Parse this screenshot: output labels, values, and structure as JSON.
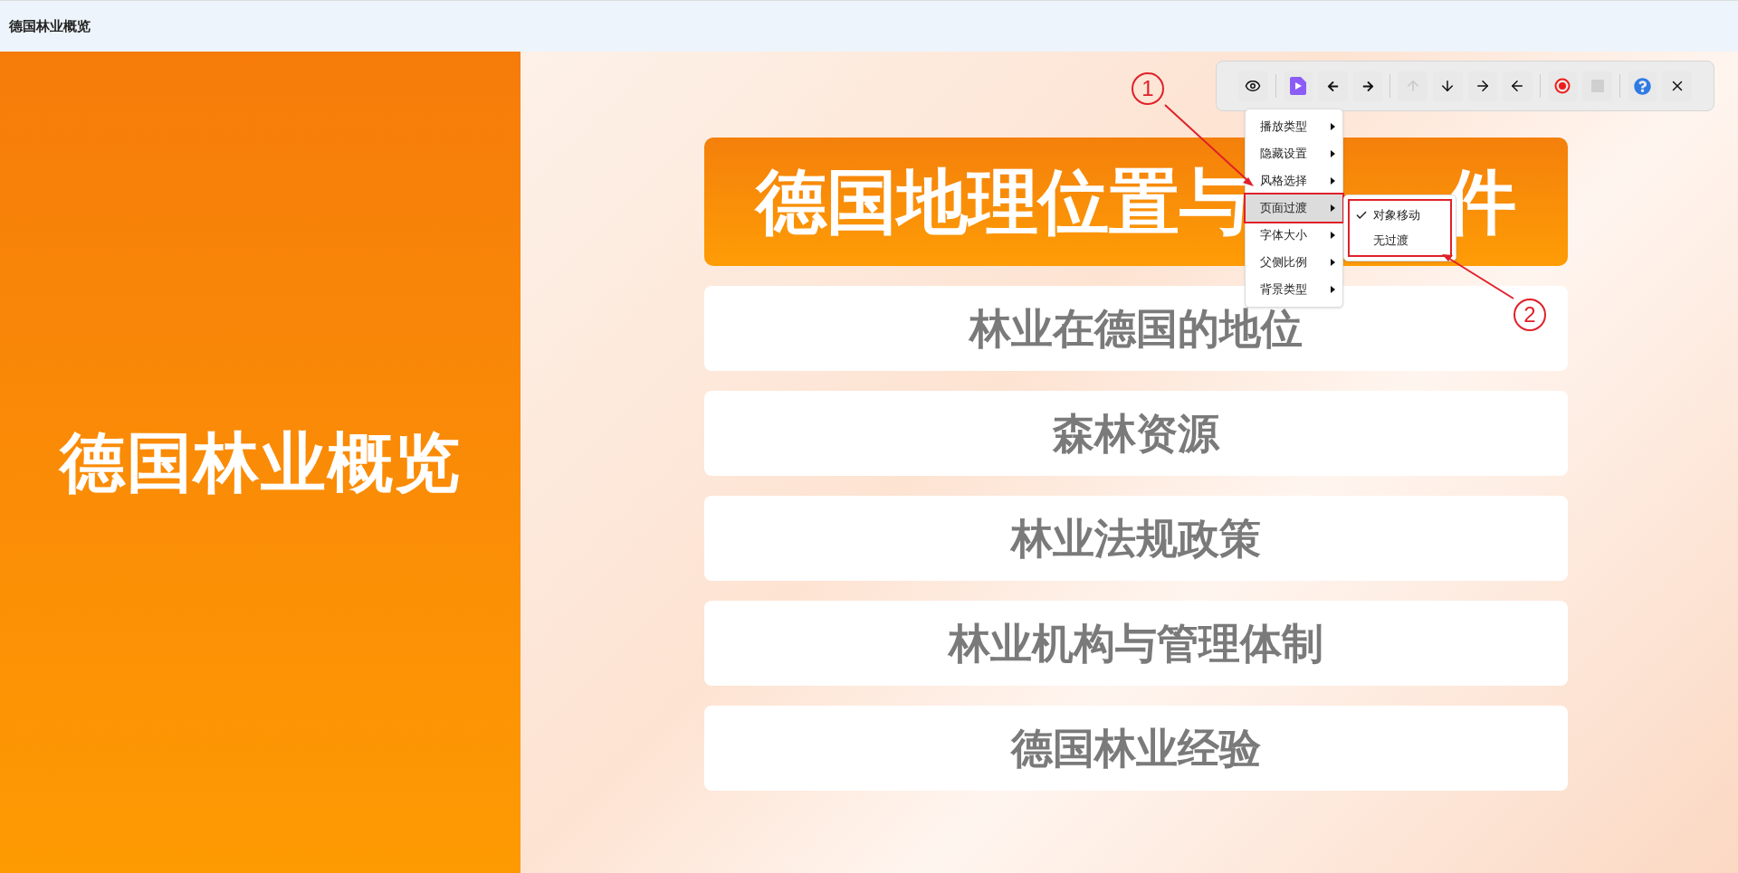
{
  "window": {
    "title": "德国林业概览"
  },
  "slide": {
    "side_title": "德国林业概览",
    "title_parts": [
      "德国地理位置与",
      "件"
    ],
    "items": [
      "林业在德国的地位",
      "森林资源",
      "林业法规政策",
      "林业机构与管理体制",
      "德国林业经验"
    ]
  },
  "toolbar": [
    {
      "kind": "eye",
      "disabled": false
    },
    {
      "kind": "sep"
    },
    {
      "kind": "video",
      "disabled": false
    },
    {
      "kind": "bold-left",
      "disabled": false
    },
    {
      "kind": "bold-right",
      "disabled": false
    },
    {
      "kind": "sep"
    },
    {
      "kind": "up",
      "disabled": true
    },
    {
      "kind": "down",
      "disabled": false
    },
    {
      "kind": "right",
      "disabled": false
    },
    {
      "kind": "left",
      "disabled": false
    },
    {
      "kind": "sep"
    },
    {
      "kind": "record",
      "disabled": false
    },
    {
      "kind": "stop",
      "disabled": true
    },
    {
      "kind": "sep"
    },
    {
      "kind": "help",
      "disabled": false
    },
    {
      "kind": "close",
      "disabled": false
    }
  ],
  "menu": [
    {
      "label": "播放类型",
      "selected": false
    },
    {
      "label": "隐藏设置",
      "selected": false
    },
    {
      "label": "风格选择",
      "selected": false
    },
    {
      "label": "页面过渡",
      "selected": true
    },
    {
      "label": "字体大小",
      "selected": false
    },
    {
      "label": "父侧比例",
      "selected": false
    },
    {
      "label": "背景类型",
      "selected": false
    }
  ],
  "submenu": [
    {
      "label": "对象移动",
      "checked": true
    },
    {
      "label": "无过渡",
      "checked": false
    }
  ],
  "annotations": [
    "1",
    "2"
  ]
}
